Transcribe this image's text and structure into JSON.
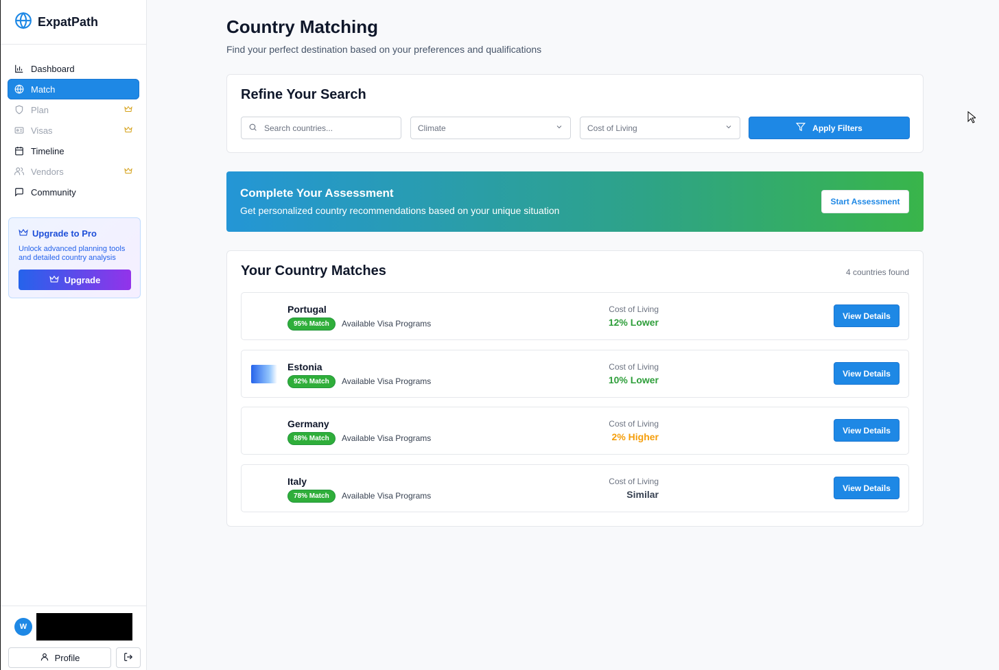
{
  "app": {
    "name": "ExpatPath"
  },
  "sidebar": {
    "items": [
      {
        "label": "Dashboard",
        "icon": "bar-chart-icon",
        "state": "normal"
      },
      {
        "label": "Match",
        "icon": "globe-icon",
        "state": "active"
      },
      {
        "label": "Plan",
        "icon": "shield-icon",
        "state": "locked"
      },
      {
        "label": "Visas",
        "icon": "id-card-icon",
        "state": "locked"
      },
      {
        "label": "Timeline",
        "icon": "calendar-icon",
        "state": "normal"
      },
      {
        "label": "Vendors",
        "icon": "users-icon",
        "state": "locked"
      },
      {
        "label": "Community",
        "icon": "message-icon",
        "state": "normal"
      }
    ],
    "pro_card": {
      "title": "Upgrade to Pro",
      "text": "Unlock advanced planning tools and detailed country analysis",
      "button": "Upgrade"
    },
    "user": {
      "initial": "W",
      "profile_label": "Profile"
    }
  },
  "page": {
    "title": "Country Matching",
    "subtitle": "Find your perfect destination based on your preferences and qualifications"
  },
  "refine": {
    "title": "Refine Your Search",
    "search_placeholder": "Search countries...",
    "climate_value": "Climate",
    "cost_value": "Cost of Living",
    "apply_label": "Apply Filters"
  },
  "banner": {
    "title": "Complete Your Assessment",
    "text": "Get personalized country recommendations based on your unique situation",
    "button": "Start Assessment"
  },
  "matches": {
    "title": "Your Country Matches",
    "count": "4 countries found",
    "rows": [
      {
        "name": "Portugal",
        "badge": "95% Match",
        "visa": "Available Visa Programs",
        "col_label": "Cost of Living",
        "col_value": "12% Lower",
        "tone": "green",
        "button": "View Details"
      },
      {
        "name": "Estonia",
        "badge": "92% Match",
        "visa": "Available Visa Programs",
        "col_label": "Cost of Living",
        "col_value": "10% Lower",
        "tone": "green",
        "button": "View Details"
      },
      {
        "name": "Germany",
        "badge": "88% Match",
        "visa": "Available Visa Programs",
        "col_label": "Cost of Living",
        "col_value": "2% Higher",
        "tone": "orange",
        "button": "View Details"
      },
      {
        "name": "Italy",
        "badge": "78% Match",
        "visa": "Available Visa Programs",
        "col_label": "Cost of Living",
        "col_value": "Similar",
        "tone": "gray",
        "button": "View Details"
      }
    ]
  },
  "colors": {
    "accent": "#1e88e5",
    "success": "#2fae3a",
    "warning": "#f59e0b",
    "pro": "#d4a017"
  }
}
